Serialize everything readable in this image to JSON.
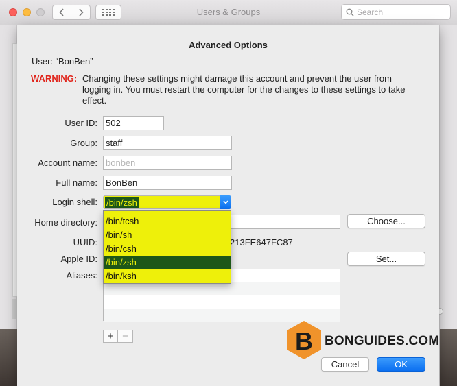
{
  "window": {
    "title": "Users & Groups"
  },
  "search": {
    "placeholder": "Search"
  },
  "sheet": {
    "title": "Advanced Options",
    "user_line": "User:  “BonBen”",
    "warning_label": "WARNING:",
    "warning_text": "Changing these settings might damage this account and prevent the user from logging in. You must restart the computer for the changes to these settings to take effect."
  },
  "fields": {
    "user_id": {
      "label": "User ID:",
      "value": "502"
    },
    "group": {
      "label": "Group:",
      "value": "staff"
    },
    "account_name": {
      "label": "Account name:",
      "value": "bonben"
    },
    "full_name": {
      "label": "Full name:",
      "value": "BonBen"
    },
    "login_shell": {
      "label": "Login shell:",
      "value": "/bin/zsh"
    },
    "home_directory": {
      "label": "Home directory:"
    },
    "uuid": {
      "label": "UUID:",
      "value": "213FE647FC87"
    },
    "apple_id": {
      "label": "Apple ID:"
    },
    "aliases": {
      "label": "Aliases:"
    }
  },
  "shell_options": [
    "/bin/tcsh",
    "/bin/sh",
    "/bin/csh",
    "/bin/zsh",
    "/bin/ksh"
  ],
  "buttons": {
    "choose": "Choose...",
    "set": "Set...",
    "add": "+",
    "remove": "−",
    "cancel": "Cancel",
    "ok": "OK"
  },
  "watermark": {
    "letter": "B",
    "text": "BONGUIDES.COM"
  },
  "colors": {
    "accent": "#0b6ff0",
    "warning": "#e0241b",
    "highlight": "#eef00a",
    "selection": "#1d5718",
    "watermark_orange": "#f0932b"
  }
}
